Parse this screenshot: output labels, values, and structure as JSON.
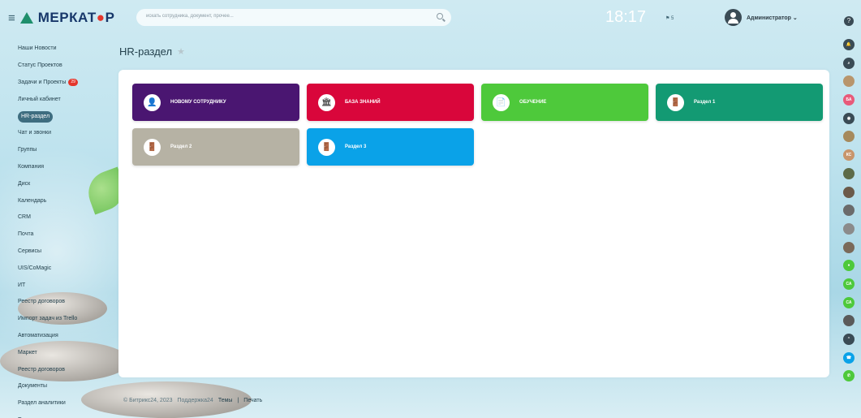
{
  "header": {
    "logo_text_1": "МЕРКАТ",
    "logo_text_2": "Р",
    "search_placeholder": "искать сотрудника, документ, прочее...",
    "clock": "18:17",
    "clock_flag": "⚑ 5",
    "user_name": "Администратор ⌄",
    "help": "?"
  },
  "menu": [
    {
      "label": "Наши Новости"
    },
    {
      "label": "Статус Проектов"
    },
    {
      "label": "Задачи и Проекты",
      "badge": "29"
    },
    {
      "label": "Личный кабинет"
    },
    {
      "label": "HR-раздел",
      "active": true
    },
    {
      "label": "Чат и звонки"
    },
    {
      "label": "Группы"
    },
    {
      "label": "Компания"
    },
    {
      "label": "Диск"
    },
    {
      "label": "Календарь"
    },
    {
      "label": "CRM"
    },
    {
      "label": "Почта"
    },
    {
      "label": "Сервисы"
    },
    {
      "label": "UIS/CoMagic"
    },
    {
      "label": "ИТ"
    },
    {
      "label": "Реестр договоров"
    },
    {
      "label": "Импорт задач из Trello"
    },
    {
      "label": "Автоматизация"
    },
    {
      "label": "Маркет"
    },
    {
      "label": "Реестр договоров"
    },
    {
      "label": "Документы"
    },
    {
      "label": "Раздел аналитики"
    },
    {
      "label": "Еще ⌄"
    }
  ],
  "page": {
    "title": "HR-раздел",
    "star": "★"
  },
  "tiles": [
    {
      "label": "НОВОМУ СОТРУДНИКУ",
      "color": "#4a1671",
      "icon": "person-icon",
      "glyph": "👤"
    },
    {
      "label": "БАЗА ЗНАНИЙ",
      "color": "#d9063b",
      "icon": "bank-icon",
      "glyph": "🏛"
    },
    {
      "label": "ОБУЧЕНИЕ",
      "color": "#4ec93b",
      "icon": "document-icon",
      "glyph": "📄"
    },
    {
      "label": "Раздел 1",
      "color": "#139a73",
      "icon": "door-icon",
      "glyph": "🚪"
    },
    {
      "label": "Раздел 2",
      "color": "#b6b2a4",
      "icon": "door-icon",
      "glyph": "🚪"
    },
    {
      "label": "Раздел 3",
      "color": "#0aa2e8",
      "icon": "door-icon",
      "glyph": "🚪"
    }
  ],
  "footer": {
    "copyright": "© Битрикс24, 2023",
    "support": "Поддержка24",
    "themes": "Темы",
    "separator": "|",
    "print": "Печать"
  },
  "rightbar": [
    {
      "icon": "notification-icon",
      "color": "#3a4b55",
      "text": "🔔"
    },
    {
      "icon": "search-icon",
      "color": "#3a4b55",
      "text": "⌕"
    },
    {
      "icon": "avatar-icon",
      "color": "#b8956c",
      "text": ""
    },
    {
      "icon": "avatar-initials-icon",
      "color": "#e85a7a",
      "text": "БА"
    },
    {
      "icon": "chat-icon",
      "color": "#3a4b55",
      "text": "◉"
    },
    {
      "icon": "avatar-icon",
      "color": "#a68a5c",
      "text": ""
    },
    {
      "icon": "avatar-initials-icon",
      "color": "#c8956c",
      "text": "КС"
    },
    {
      "icon": "avatar-icon",
      "color": "#5d6b48",
      "text": ""
    },
    {
      "icon": "avatar-icon",
      "color": "#6b5a4a",
      "text": ""
    },
    {
      "icon": "avatar-icon",
      "color": "#6b6b6b",
      "text": ""
    },
    {
      "icon": "avatar-icon",
      "color": "#8b8b8b",
      "text": ""
    },
    {
      "icon": "avatar-icon",
      "color": "#7a6a5a",
      "text": ""
    },
    {
      "icon": "chat-icon",
      "color": "#4ec93b",
      "text": "●"
    },
    {
      "icon": "avatar-initials-icon",
      "color": "#4ec93b",
      "text": "СА"
    },
    {
      "icon": "avatar-initials-icon",
      "color": "#4ec93b",
      "text": "СА"
    },
    {
      "icon": "avatar-icon",
      "color": "#5a5a5a",
      "text": ""
    },
    {
      "icon": "chevron-up-icon",
      "color": "#3a4b55",
      "text": "⌃"
    },
    {
      "icon": "call-icon",
      "color": "#0aa2e8",
      "text": "☎"
    },
    {
      "icon": "phone-icon",
      "color": "#4ec93b",
      "text": "✆"
    }
  ]
}
